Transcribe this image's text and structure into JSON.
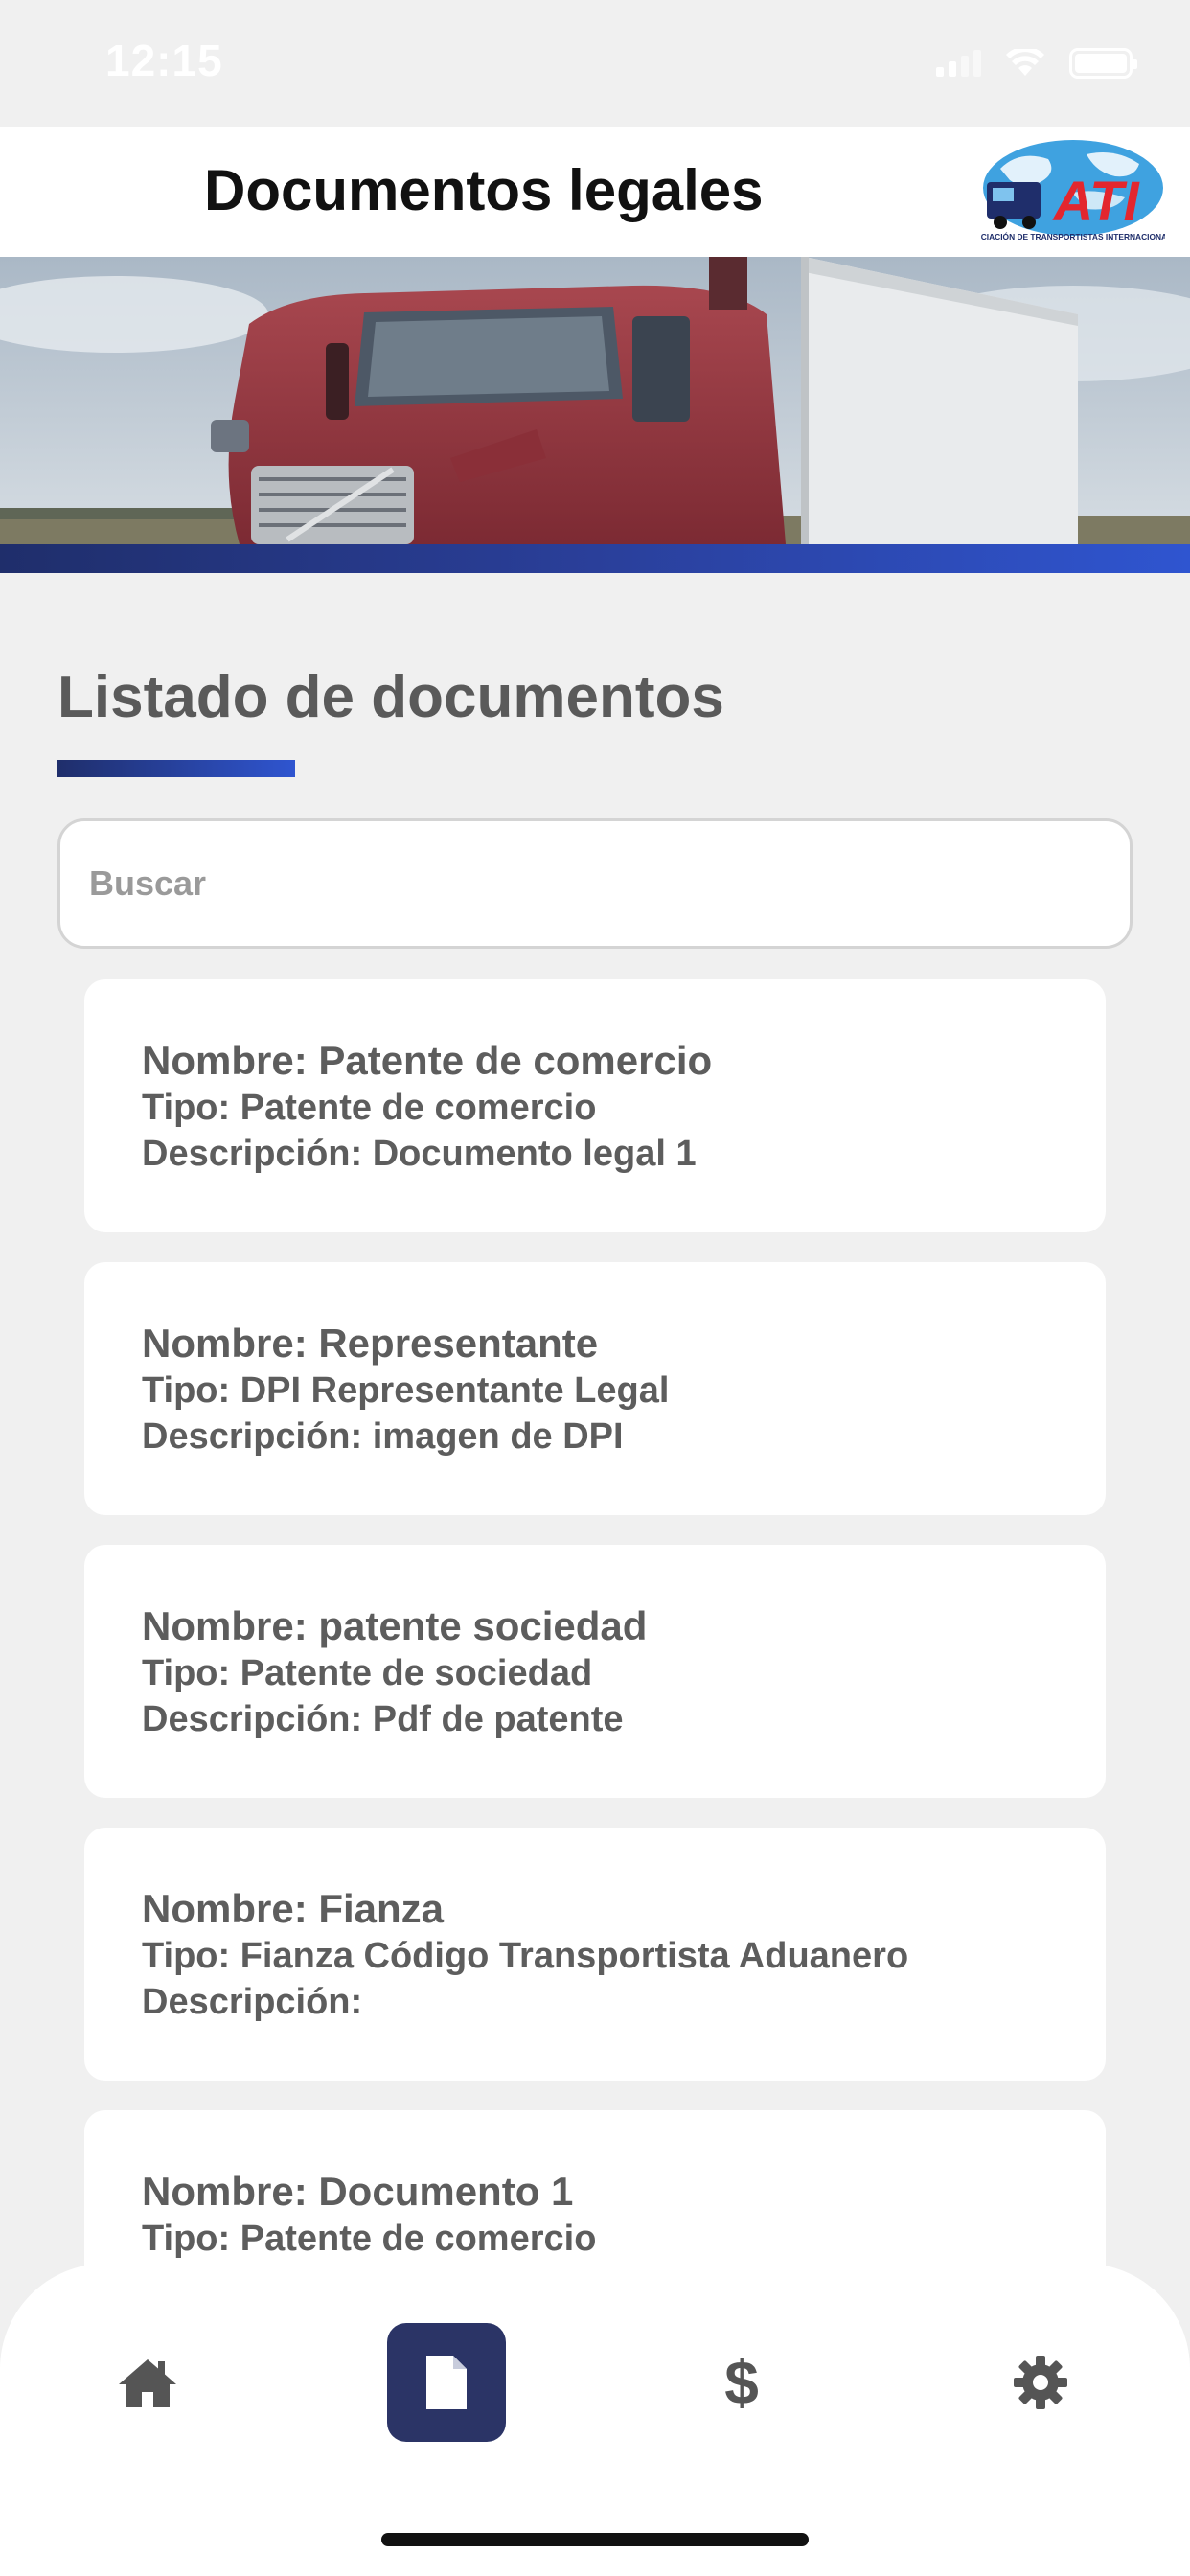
{
  "status_bar": {
    "time": "12:15",
    "icons": [
      "signal-icon",
      "wifi-icon",
      "battery-icon"
    ]
  },
  "header": {
    "title": "Documentos legales",
    "logo": {
      "text": "ATI",
      "tagline": "ASOCIACIÓN DE TRANSPORTISTAS INTERNACIONALES"
    }
  },
  "section": {
    "title": "Listado de documentos"
  },
  "search": {
    "placeholder": "Buscar",
    "value": ""
  },
  "documents": [
    {
      "name_line": "Nombre: Patente de comercio",
      "type_line": "Tipo: Patente de comercio",
      "description_line": "Descripción: Documento legal 1"
    },
    {
      "name_line": "Nombre: Representante",
      "type_line": "Tipo: DPI Representante Legal",
      "description_line": "Descripción: imagen de DPI"
    },
    {
      "name_line": "Nombre: patente sociedad",
      "type_line": "Tipo: Patente de sociedad",
      "description_line": "Descripción: Pdf de patente"
    },
    {
      "name_line": "Nombre: Fianza",
      "type_line": "Tipo: Fianza Código Transportista Aduanero",
      "description_line": "Descripción:"
    },
    {
      "name_line": "Nombre: Documento 1",
      "type_line": "Tipo: Patente de comercio",
      "description_line": ""
    }
  ],
  "bottom_nav": {
    "items": [
      {
        "icon": "home-icon",
        "active": false
      },
      {
        "icon": "document-icon",
        "active": true
      },
      {
        "icon": "dollar-icon",
        "label": "$",
        "active": false
      },
      {
        "icon": "gear-icon",
        "active": false
      }
    ]
  },
  "colors": {
    "accent": "#2b3466",
    "banner_strip": "#2f55d0",
    "background": "#f0f0f0"
  }
}
